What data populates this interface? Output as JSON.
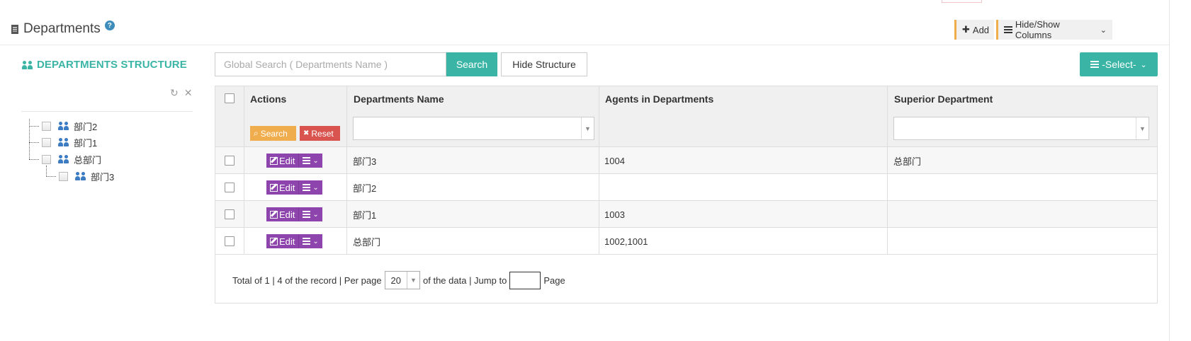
{
  "header": {
    "title": "Departments",
    "help": "?",
    "add_label": "Add",
    "add_glyph": "✚",
    "columns_label": "Hide/Show Columns",
    "chevron": "⌄"
  },
  "structure": {
    "title": "DEPARTMENTS STRUCTURE",
    "refresh_glyph": "↻",
    "close_glyph": "✕",
    "nodes": [
      {
        "label": "部门2"
      },
      {
        "label": "部门1"
      },
      {
        "label": "总部门"
      },
      {
        "label": "部门3"
      }
    ]
  },
  "toolbar": {
    "search_placeholder": "Global Search ( Departments Name )",
    "search_label": "Search",
    "hide_structure_label": "Hide Structure",
    "select_label": "-Select-"
  },
  "table": {
    "columns": [
      "Actions",
      "Departments Name",
      "Agents in Departments",
      "Superior Department"
    ],
    "filter_search_label": "Search",
    "filter_reset_label": "Reset",
    "filter_search_glyph": "⌕",
    "filter_reset_glyph": "✖",
    "caret": "▼",
    "edit_label": "Edit",
    "rows": [
      {
        "name": "部门3",
        "agents": "1004",
        "superior": "总部门"
      },
      {
        "name": "部门2",
        "agents": "",
        "superior": ""
      },
      {
        "name": "部门1",
        "agents": "1003",
        "superior": ""
      },
      {
        "name": "总部门",
        "agents": "1002,1001",
        "superior": ""
      }
    ]
  },
  "pagination": {
    "summary": "Total of 1 | 4 of the record | Per page",
    "per_page": "20",
    "after_per_page": "of the data | Jump to",
    "page_label": "Page"
  },
  "colors": {
    "teal": "#3ab5a5",
    "purple": "#8e44ad",
    "orange": "#f0ad4e",
    "red": "#d9534f"
  }
}
